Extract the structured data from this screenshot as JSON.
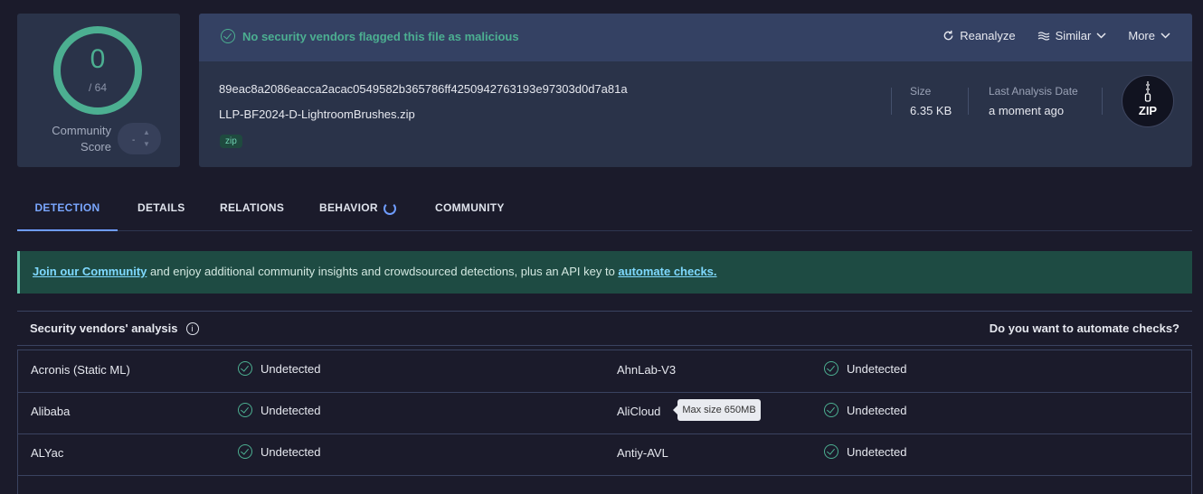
{
  "score": {
    "detected": "0",
    "total": "/ 64",
    "community_label": "Community\nScore",
    "community_value": "-"
  },
  "banner": {
    "status": "No security vendors flagged this file as malicious",
    "reanalyze": "Reanalyze",
    "similar": "Similar",
    "more": "More"
  },
  "file": {
    "hash": "89eac8a2086eacca2acac0549582b365786ff4250942763193e97303d0d7a81a",
    "name": "LLP-BF2024-D-LightroomBrushes.zip",
    "tag": "zip",
    "size_label": "Size",
    "size_value": "6.35 KB",
    "date_label": "Last Analysis Date",
    "date_value": "a moment ago",
    "type_icon_text": "ZIP"
  },
  "tabs": [
    "DETECTION",
    "DETAILS",
    "RELATIONS",
    "BEHAVIOR",
    "COMMUNITY"
  ],
  "notice": {
    "link1": "Join our Community",
    "text": " and enjoy additional community insights and crowdsourced detections, plus an API key to ",
    "link2": "automate checks."
  },
  "vendors": {
    "title": "Security vendors' analysis",
    "automate": "Do you want to automate checks?",
    "rows": [
      {
        "left_vendor": "Acronis (Static ML)",
        "left_status": "Undetected",
        "right_vendor": "AhnLab-V3",
        "right_status": "Undetected"
      },
      {
        "left_vendor": "Alibaba",
        "left_status": "Undetected",
        "right_vendor": "AliCloud",
        "right_status": "Undetected"
      },
      {
        "left_vendor": "ALYac",
        "left_status": "Undetected",
        "right_vendor": "Antiy-AVL",
        "right_status": "Undetected"
      }
    ]
  },
  "tooltip": "Max size 650MB",
  "colors": {
    "bg": "#1b1b2b",
    "card": "#2a3349",
    "accent_green": "#4caf91",
    "tab_active": "#7aa7ff"
  }
}
